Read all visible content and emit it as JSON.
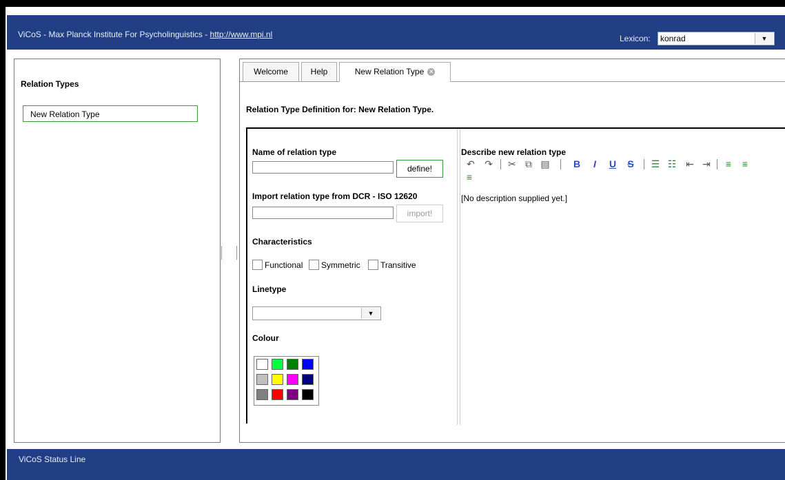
{
  "header": {
    "app_title": "ViCoS - Max Planck Institute For Psycholinguistics - ",
    "link": "http://www.mpi.nl",
    "lexicon_label": "Lexicon:",
    "lexicon_value": "konrad",
    "dropdown_arrow": "▼",
    "bg_color": "#223f85"
  },
  "left": {
    "title": "Relation Types",
    "items": [
      {
        "label": "New Relation Type"
      }
    ]
  },
  "tabs": [
    {
      "label": "Welcome"
    },
    {
      "label": "Help"
    },
    {
      "label": "New Relation Type",
      "close": "✕",
      "active": true
    }
  ],
  "main": {
    "definition_title": "Relation Type Definition for: New Relation Type.",
    "name_label": "Name of relation type",
    "define_button": "define!",
    "import_label": "Import relation type from DCR - ISO 12620",
    "import_button": "import!",
    "characteristics_label": "Characteristics",
    "characteristics": [
      {
        "label": "Functional"
      },
      {
        "label": "Symmetric"
      },
      {
        "label": "Transitive"
      }
    ],
    "linetype_label": "Linetype",
    "linetype_arrow": "▼",
    "colour_label": "Colour",
    "colours": [
      "#ffffff",
      "#00ff3c",
      "#008000",
      "#0000ff",
      "#c0c0c0",
      "#ffff00",
      "#ff00ff",
      "#000080",
      "#808080",
      "#ff0000",
      "#800080",
      "#000000"
    ]
  },
  "editor": {
    "title": "Describe new relation type",
    "content": "[No description supplied yet.]",
    "toolbar": [
      "undo-icon",
      "redo-icon",
      "cut-icon",
      "copy-icon",
      "paste-icon",
      "bold-icon",
      "italic-icon",
      "underline-icon",
      "strikethrough-icon",
      "ordered-list-icon",
      "unordered-list-icon",
      "outdent-icon",
      "indent-icon",
      "align-left-icon",
      "align-center-icon",
      "align-right-icon"
    ]
  },
  "status": {
    "text": "ViCoS Status Line"
  }
}
